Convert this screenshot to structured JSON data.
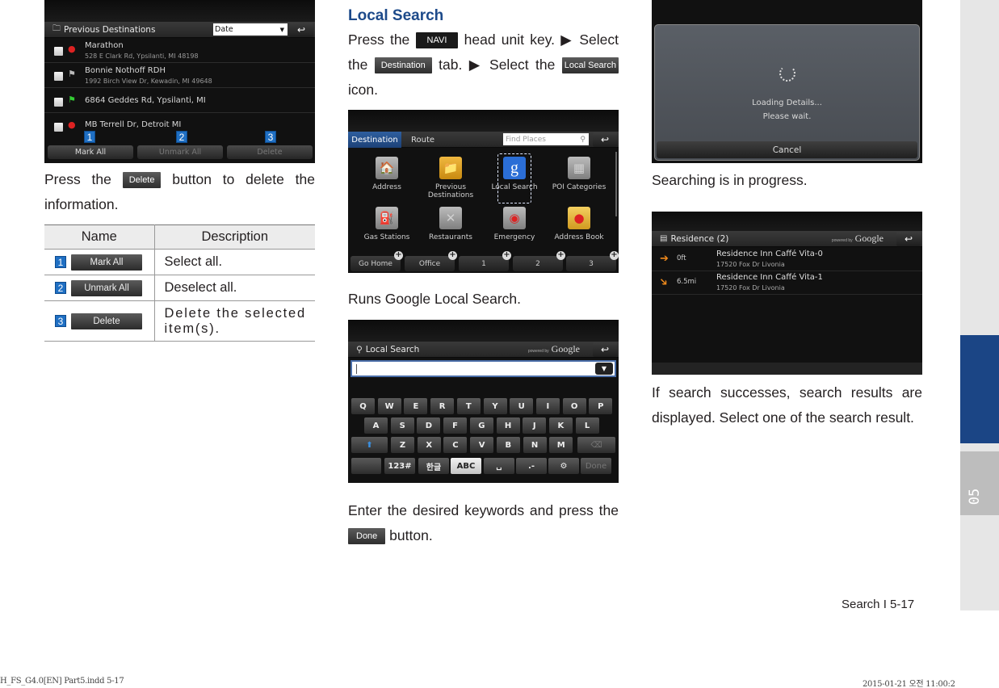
{
  "previous_destinations_screen": {
    "title": "Previous Destinations",
    "sort_select": "Date",
    "back_icon": "back-arrow-icon",
    "items": [
      {
        "name": "Marathon",
        "address": "528 E Clark Rd, Ypsilanti, MI 48198",
        "icon": "red-pin-icon"
      },
      {
        "name": "Bonnie Nothoff RDH",
        "address": "1992 Birch View Dr, Kewadin, MI 49648",
        "icon": "white-flag-icon"
      },
      {
        "name": "6864 Geddes Rd, Ypsilanti, MI",
        "address": "",
        "icon": "green-flag-icon"
      },
      {
        "name": "MB Terrell Dr, Detroit MI",
        "address": "",
        "icon": "red-pin-icon"
      }
    ],
    "buttons": [
      {
        "num": "1",
        "label": "Mark All"
      },
      {
        "num": "2",
        "label": "Unmark All"
      },
      {
        "num": "3",
        "label": "Delete"
      }
    ]
  },
  "delete_instruction": {
    "before": "Press the",
    "button": "Delete",
    "after": "button to delete the information."
  },
  "table": {
    "headers": [
      "Name",
      "Description"
    ],
    "rows": [
      {
        "num": "1",
        "button": "Mark All",
        "description": "Select all."
      },
      {
        "num": "2",
        "button": "Unmark All",
        "description": "Deselect all."
      },
      {
        "num": "3",
        "button": "Delete",
        "description": "Delete the selected item(s)."
      }
    ]
  },
  "local_search": {
    "heading": "Local Search",
    "step_text": {
      "p1": "Press the",
      "navi_key": "NAVI",
      "p2": "head unit key. ▶ Select the",
      "destination_tab": "Destination",
      "p3": "tab. ▶ Select the",
      "local_search_icon": "Local Search",
      "p4": "icon."
    }
  },
  "destination_screen": {
    "tabs": [
      "Destination",
      "Route"
    ],
    "search_placeholder": "Find Places",
    "menu": [
      {
        "label": "Address",
        "icon": "house-icon"
      },
      {
        "label": "Previous Destinations",
        "icon": "folder-icon"
      },
      {
        "label": "Local Search",
        "icon": "google-icon",
        "selected": true
      },
      {
        "label": "POI Categories",
        "icon": "poi-icon"
      },
      {
        "label": "Gas Stations",
        "icon": "gas-pump-icon"
      },
      {
        "label": "Restaurants",
        "icon": "utensils-icon"
      },
      {
        "label": "Emergency",
        "icon": "siren-icon"
      },
      {
        "label": "Address Book",
        "icon": "address-book-icon"
      }
    ],
    "favorites": [
      "Go Home",
      "Office",
      "1",
      "2",
      "3"
    ]
  },
  "google_caption": "Runs Google Local Search.",
  "keyboard_screen": {
    "title": "Local Search",
    "powered_by": "powered by",
    "brand": "Google",
    "input_value": "",
    "rows": [
      [
        "Q",
        "W",
        "E",
        "R",
        "T",
        "Y",
        "U",
        "I",
        "O",
        "P"
      ],
      [
        "A",
        "S",
        "D",
        "F",
        "G",
        "H",
        "J",
        "K",
        "L"
      ],
      [
        "Z",
        "X",
        "C",
        "V",
        "B",
        "N",
        "M"
      ]
    ],
    "bottom_row": [
      "123#",
      "한글",
      "ABC",
      "␣",
      ".-",
      "⚙",
      "Done"
    ]
  },
  "keyboard_caption": {
    "p1": "Enter the desired keywords and press the",
    "button": "Done",
    "p2": "button."
  },
  "loading_screen": {
    "line1": "Loading Details...",
    "line2": "Please wait.",
    "cancel": "Cancel"
  },
  "loading_caption": "Searching is in progress.",
  "results_screen": {
    "title": "Residence (2)",
    "powered_by": "powered by",
    "brand": "Google",
    "results": [
      {
        "distance": "0ft",
        "name": "Residence Inn Caffé Vita-0",
        "address": "17520 Fox Dr Livonia",
        "direction": "east"
      },
      {
        "distance": "6.5mi",
        "name": "Residence Inn Caffé Vita-1",
        "address": "17520 Fox Dr Livonia",
        "direction": "southeast"
      }
    ]
  },
  "results_caption": "If search successes, search results are displayed. Select one of the search result.",
  "chapter_tab": "05",
  "page_footer": "Search I 5-17",
  "slug_left": "H_FS_G4.0[EN] Part5.indd   5-17",
  "slug_right": "2015-01-21   오전 11:00:2",
  "colors": {
    "heading_blue": "#1d4a8a",
    "chapter_blue": "#1b4585",
    "badge_blue": "#1f6fc3",
    "result_arrow": "#f08a1c"
  }
}
